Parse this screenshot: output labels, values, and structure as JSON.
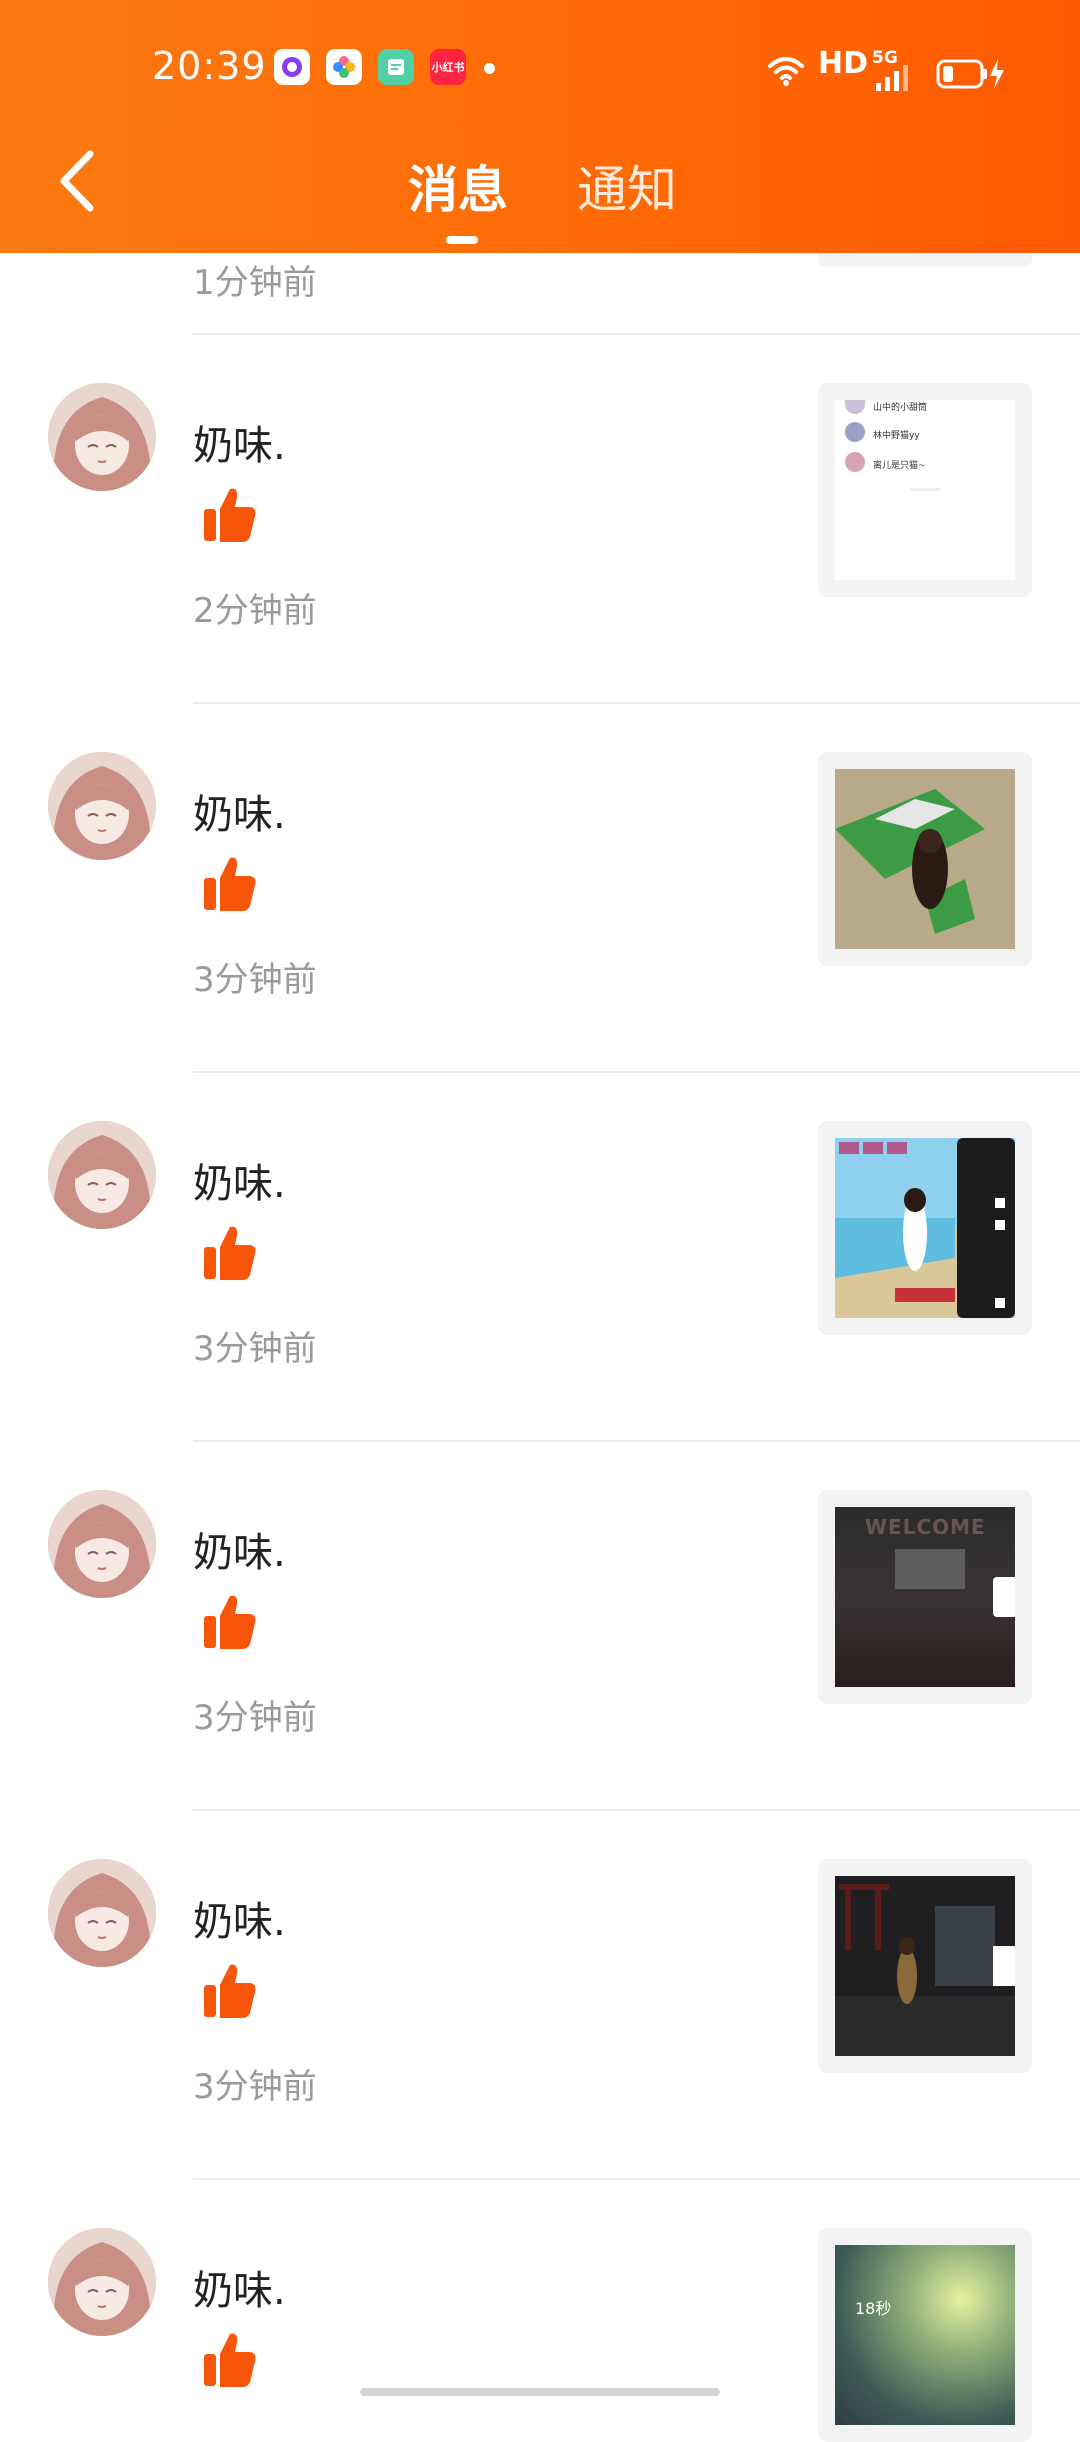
{
  "status_bar": {
    "time": "20:39",
    "app_icons": [
      {
        "name": "purple-ring-app-icon",
        "color": "#7b3cf0"
      },
      {
        "name": "photos-flower-app-icon",
        "color": "#ffffff"
      },
      {
        "name": "green-calendar-app-icon",
        "color": "#4fd1a5"
      },
      {
        "name": "xiaohongshu-app-icon",
        "color": "#ff2442",
        "label": "小红书"
      }
    ],
    "network": "HD",
    "signal_type": "5G"
  },
  "header": {
    "tabs": [
      {
        "label": "消息",
        "active": true
      },
      {
        "label": "通知",
        "active": false
      }
    ]
  },
  "colors": {
    "accent": "#ff6a06",
    "like": "#f7550a",
    "timestamp": "#9a9a9a"
  },
  "top_partial": {
    "time": "1分钟前"
  },
  "messages": [
    {
      "name": "奶味.",
      "time": "2分钟前",
      "thumb": "list-screenshot"
    },
    {
      "name": "奶味.",
      "time": "3分钟前",
      "thumb": "green-tile-game-scene"
    },
    {
      "name": "奶味.",
      "time": "3分钟前",
      "thumb": "beach-menu-game-scene"
    },
    {
      "name": "奶味.",
      "time": "3分钟前",
      "thumb": "welcome-night-game-scene"
    },
    {
      "name": "奶味.",
      "time": "3分钟前",
      "thumb": "night-street-game-scene"
    },
    {
      "name": "奶味.",
      "time": "",
      "thumb": "bokeh-video-scene"
    }
  ],
  "thumb_texts": {
    "list_lines": [
      "山中的小甜筒",
      "林中野猫yy",
      "离儿是只猫~"
    ],
    "welcome": "WELCOME",
    "video_time": "18秒"
  }
}
